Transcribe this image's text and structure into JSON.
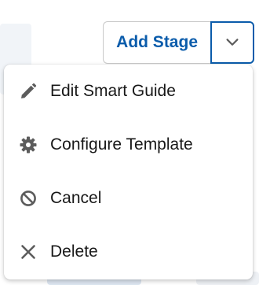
{
  "toolbar": {
    "add_stage_label": "Add Stage",
    "dropdown_icon": "chevron-down-icon"
  },
  "menu": {
    "items": [
      {
        "label": "Edit Smart Guide",
        "icon": "pencil-icon"
      },
      {
        "label": "Configure Template",
        "icon": "gear-icon"
      },
      {
        "label": "Cancel",
        "icon": "ban-icon"
      },
      {
        "label": "Delete",
        "icon": "close-icon"
      }
    ]
  },
  "colors": {
    "brand_blue": "#0b5cab",
    "text": "#181818",
    "icon": "#5c5c5c"
  }
}
